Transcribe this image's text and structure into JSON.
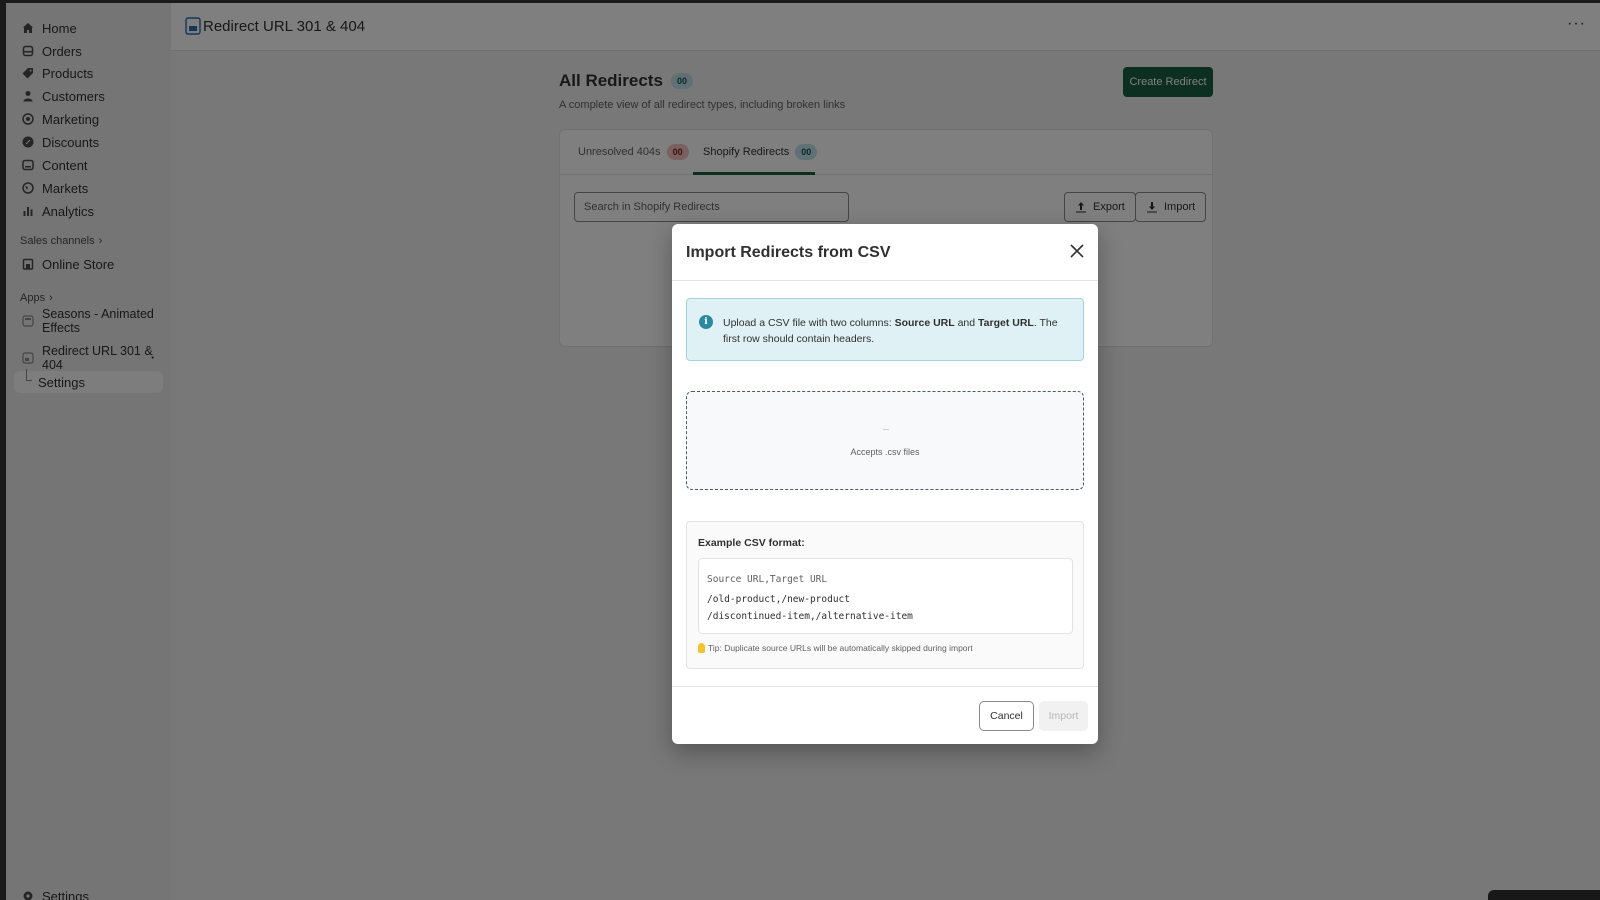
{
  "sidebar": {
    "items": [
      {
        "label": "Home",
        "icon": "home-icon"
      },
      {
        "label": "Orders",
        "icon": "orders-icon"
      },
      {
        "label": "Products",
        "icon": "tag-icon"
      },
      {
        "label": "Customers",
        "icon": "person-icon"
      },
      {
        "label": "Marketing",
        "icon": "target-icon"
      },
      {
        "label": "Discounts",
        "icon": "discount-icon"
      },
      {
        "label": "Content",
        "icon": "content-icon"
      },
      {
        "label": "Markets",
        "icon": "globe-icon"
      },
      {
        "label": "Analytics",
        "icon": "bar-chart-icon"
      }
    ],
    "sales_channels_label": "Sales channels",
    "online_store": "Online Store",
    "apps_label": "Apps",
    "app_seasons": "Seasons - Animated Effects",
    "app_redirect": "Redirect URL 301 & 404",
    "app_redirect_settings": "Settings",
    "settings": "Settings"
  },
  "topbar": {
    "app_title": "Redirect URL 301 & 404",
    "more": "···"
  },
  "page": {
    "title": "All Redirects",
    "count": "00",
    "subtitle": "A complete view of all redirect types, including broken links",
    "create_button": "Create Redirect",
    "tabs": [
      {
        "label": "Unresolved 404s",
        "count": "00"
      },
      {
        "label": "Shopify Redirects",
        "count": "00"
      }
    ],
    "search_placeholder": "Search in Shopify Redirects",
    "export_label": "Export",
    "import_label": "Import"
  },
  "modal": {
    "title": "Import Redirects from CSV",
    "info_prefix": "Upload a CSV file with two columns: ",
    "info_source": "Source URL",
    "info_and": " and ",
    "info_target": "Target URL",
    "info_suffix": ". The first row should contain headers.",
    "drop_hint": "Accepts .csv files",
    "example_title": "Example CSV format:",
    "code_header": "Source URL,Target URL",
    "code_lines": [
      "/old-product,/new-product",
      "/discontinued-item,/alternative-item"
    ],
    "tip": "Tip: Duplicate source URLs will be automatically skipped during import",
    "cancel": "Cancel",
    "import": "Import"
  },
  "colors": {
    "primary": "#1a5e45",
    "info_bg": "#e0f1f5",
    "badge_teal": "#bfe3e8",
    "badge_red": "#f5c1bd"
  }
}
